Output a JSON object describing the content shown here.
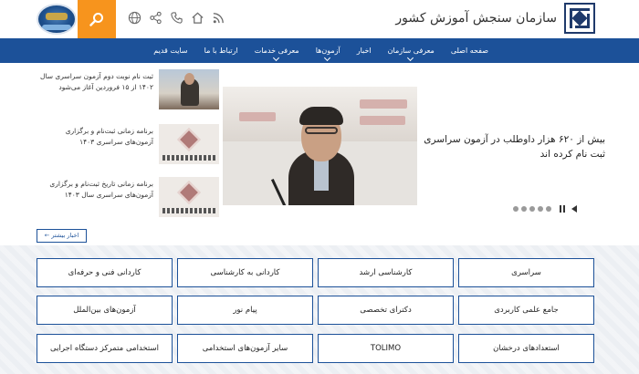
{
  "header": {
    "brand_name": "سازمان سنجش آموزش کشور",
    "icons": [
      "rss-icon",
      "phone-icon",
      "home-icon",
      "share-icon",
      "globe-icon"
    ],
    "search_icon": "search-icon"
  },
  "nav": {
    "items": [
      {
        "label": "صفحه اصلی",
        "dropdown": false
      },
      {
        "label": "معرفی سازمان",
        "dropdown": true
      },
      {
        "label": "اخبار",
        "dropdown": false
      },
      {
        "label": "آزمون‌ها",
        "dropdown": true
      },
      {
        "label": "معرفی خدمات",
        "dropdown": true
      },
      {
        "label": "ارتباط با ما",
        "dropdown": false
      },
      {
        "label": "سایت قدیم",
        "dropdown": false
      }
    ]
  },
  "news": {
    "headline": "بیش از ۶۲۰ هزار داوطلب در آزمون سراسری ثبت نام کرده اند",
    "side_items": [
      {
        "text": "ثبت نام نوبت دوم آزمون سراسری سال ۱۴۰۲ از ۱۵ فروردین آغاز می‌شود"
      },
      {
        "text": "برنامه زمانی ثبت‌نام و برگزاری آزمون‌های سراسری ۱۴۰۳"
      },
      {
        "text": "برنامه زمانی تاریخ ثبت‌نام و برگزاری آزمون‌های سراسری سال ۱۴۰۳"
      }
    ],
    "slider_dots": 5,
    "more_label": "اخبار بیشتر ←"
  },
  "exams": {
    "rows": [
      [
        "سراسری",
        "کارشناسی ارشد",
        "کاردانی به کارشناسی",
        "کاردانی فنی و حرفه‌ای"
      ],
      [
        "جامع علمی کاربردی",
        "دکترای تخصصی",
        "پیام نور",
        "آزمون‌های بین‌الملل"
      ],
      [
        "استعدادهای درخشان",
        "TOLIMO",
        "سایر آزمون‌های استخدامی",
        "استخدامی متمرکز دستگاه اجرایی"
      ]
    ]
  },
  "colors": {
    "primary": "#1c5199",
    "accent": "#f7941d",
    "grid_bg": "#eceff3"
  }
}
